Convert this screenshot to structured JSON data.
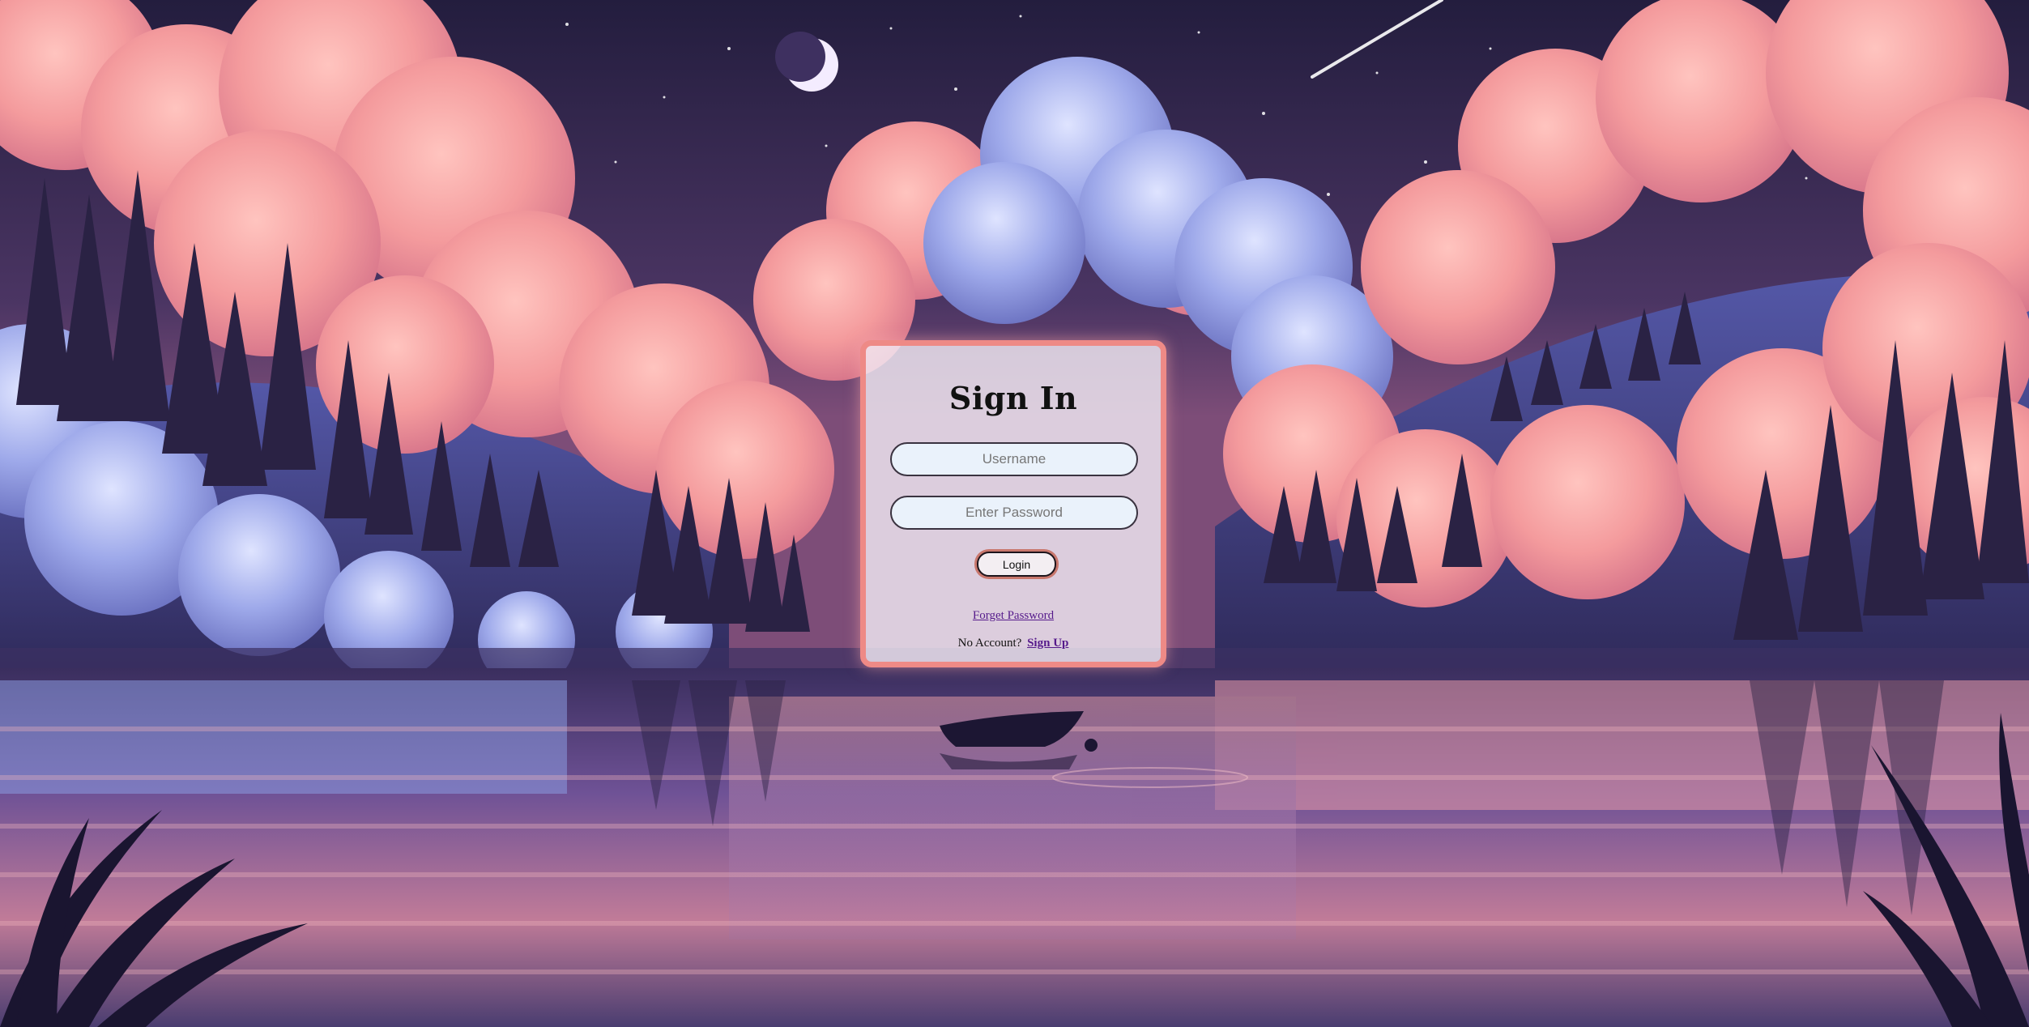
{
  "login": {
    "title": "Sign In",
    "username_placeholder": "Username",
    "password_placeholder": "Enter Password",
    "login_label": "Login",
    "forgot_label": "Forget Password",
    "no_account_text": "No Account?",
    "signup_label": "Sign Up"
  },
  "colors": {
    "sky": "#2c2547",
    "cloud_pink": "#f29a99",
    "cloud_blue": "#7f8fd6",
    "card_border": "#ee8a86",
    "link": "#551a8b"
  }
}
